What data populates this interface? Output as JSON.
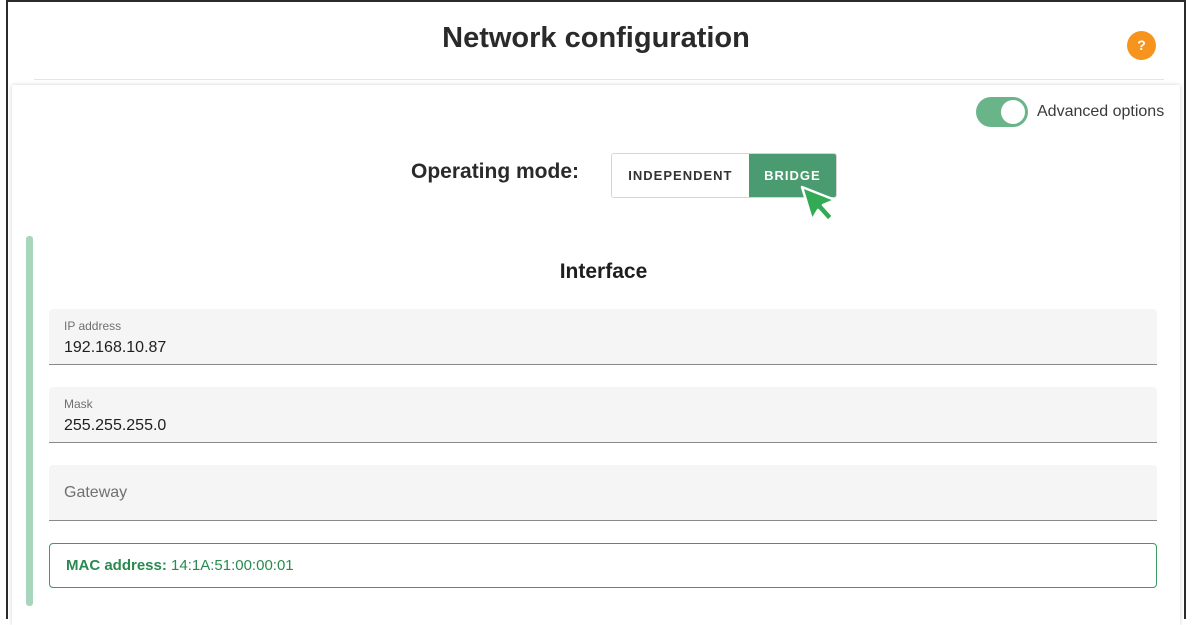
{
  "header": {
    "title": "Network configuration",
    "help_label": "?"
  },
  "advanced": {
    "label": "Advanced options",
    "enabled": true
  },
  "operating_mode": {
    "label": "Operating mode:",
    "options": [
      {
        "label": "INDEPENDENT",
        "selected": false
      },
      {
        "label": "BRIDGE",
        "selected": true
      }
    ]
  },
  "interface": {
    "title": "Interface",
    "fields": [
      {
        "label": "IP address",
        "value": "192.168.10.87"
      },
      {
        "label": "Mask",
        "value": "255.255.255.0"
      },
      {
        "placeholder": "Gateway",
        "value": ""
      }
    ],
    "mac": {
      "label": "MAC address:",
      "value": "14:1A:51:00:00:01"
    }
  },
  "colors": {
    "accent_green": "#4a9b6f",
    "toggle_green": "#6ab48a",
    "help_orange": "#f7941d",
    "mac_green": "#2a8a4f"
  },
  "icons": {
    "cursor": "pointer-cursor-icon",
    "help": "help-icon"
  }
}
